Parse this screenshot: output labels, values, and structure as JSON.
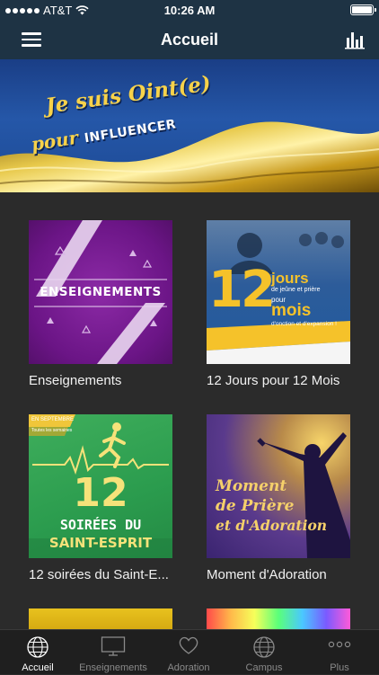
{
  "status_bar": {
    "carrier": "AT&T",
    "time": "10:26 AM"
  },
  "nav": {
    "title": "Accueil"
  },
  "banner": {
    "line1": "Je suis Oint(e)",
    "line2_prefix": "pour",
    "line2_emphasis": "INFLUENCER"
  },
  "tiles": [
    {
      "label": "Enseignements",
      "art_text": "ENSEIGNEMENTS"
    },
    {
      "label": "12 Jours pour 12 Mois",
      "art_number": "12",
      "art_word1": "jours",
      "art_sub1": "de jeûne et prière",
      "art_word_pour": "pour",
      "art_word2": "mois",
      "art_sub2": "d'onction et d'expansion !"
    },
    {
      "label": "12 soirées du Saint-E...",
      "art_tag": "EN SEPTEMBRE",
      "art_tag2": "Toutes les semaines",
      "art_number": "12",
      "art_line1": "SOIRÉES DU",
      "art_line2": "SAINT-ESPRIT"
    },
    {
      "label": "Moment d'Adoration",
      "art_line1": "Moment",
      "art_line2": "de Prière",
      "art_line3": "et d'Adoration"
    }
  ],
  "tabs": [
    {
      "label": "Accueil",
      "icon": "globe-icon",
      "active": true
    },
    {
      "label": "Enseignements",
      "icon": "monitor-icon",
      "active": false
    },
    {
      "label": "Adoration",
      "icon": "heart-icon",
      "active": false
    },
    {
      "label": "Campus",
      "icon": "globe-icon",
      "active": false
    },
    {
      "label": "Plus",
      "icon": "more-icon",
      "active": false
    }
  ]
}
